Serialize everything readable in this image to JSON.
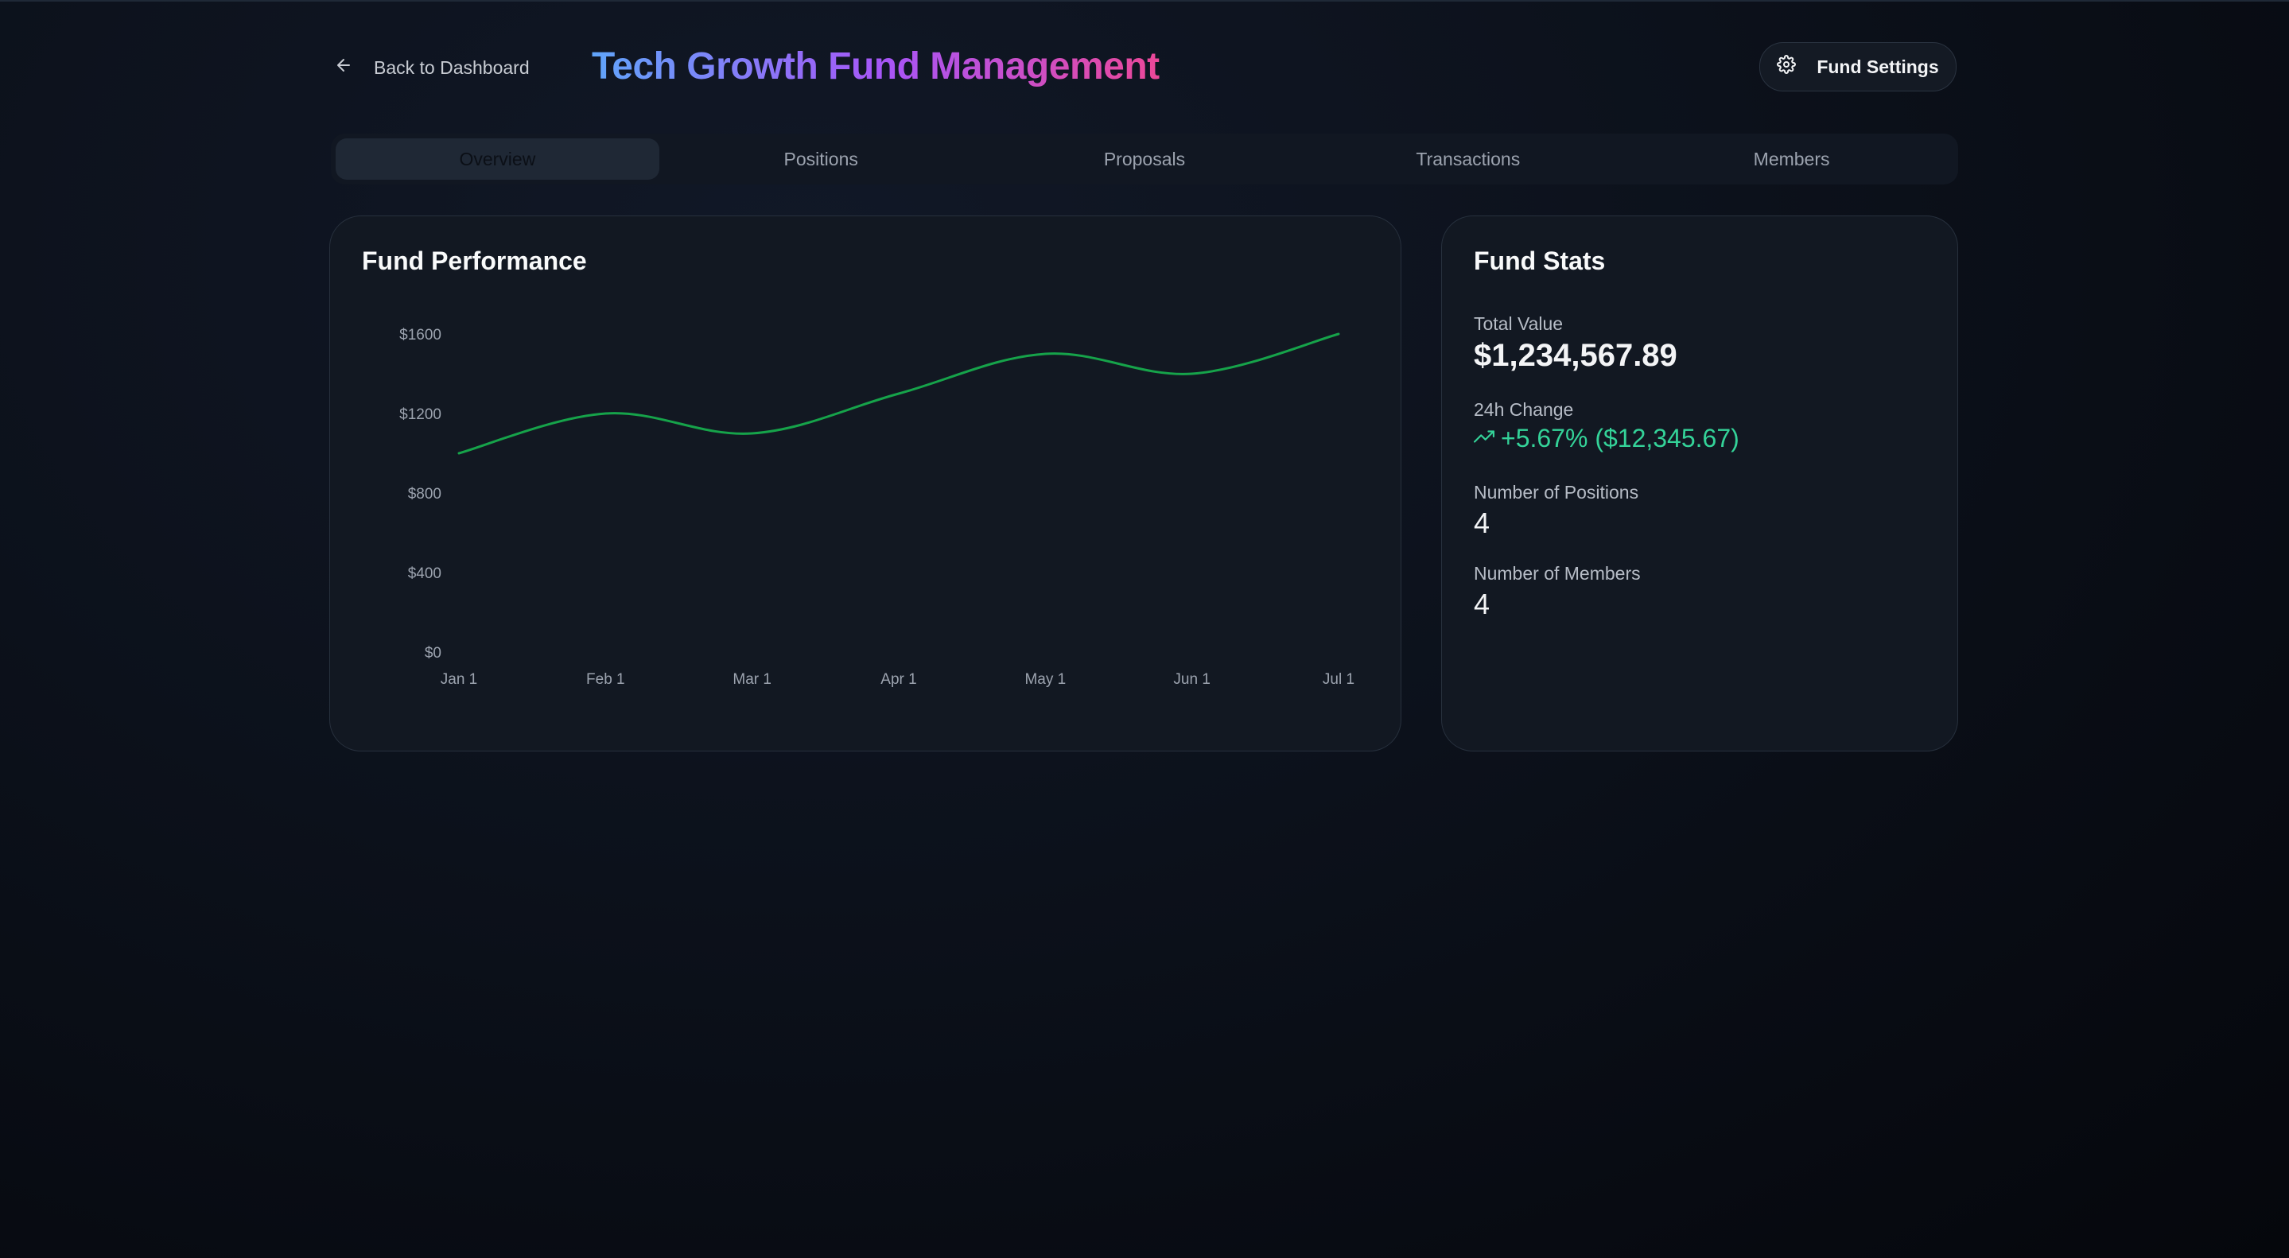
{
  "header": {
    "back_label": "Back to Dashboard",
    "title": "Tech Growth Fund Management",
    "settings_label": "Fund Settings"
  },
  "tabs": [
    {
      "label": "Overview",
      "active": true
    },
    {
      "label": "Positions",
      "active": false
    },
    {
      "label": "Proposals",
      "active": false
    },
    {
      "label": "Transactions",
      "active": false
    },
    {
      "label": "Members",
      "active": false
    }
  ],
  "performance": {
    "title": "Fund Performance"
  },
  "chart_data": {
    "type": "line",
    "title": "Fund Performance",
    "x": [
      "Jan 1",
      "Feb 1",
      "Mar 1",
      "Apr 1",
      "May 1",
      "Jun 1",
      "Jul 1"
    ],
    "series": [
      {
        "values": [
          1000,
          1200,
          1100,
          1300,
          1500,
          1400,
          1600
        ]
      }
    ],
    "yticks": [
      "$0",
      "$400",
      "$800",
      "$1200",
      "$1600"
    ],
    "ytick_values": [
      0,
      400,
      800,
      1200,
      1600
    ],
    "ylim": [
      0,
      1600
    ],
    "line_color": "#16a34a",
    "grid": false,
    "xlabel": "",
    "ylabel": ""
  },
  "stats": {
    "title": "Fund Stats",
    "total_value_label": "Total Value",
    "total_value": "$1,234,567.89",
    "change_label": "24h Change",
    "change_value": "+5.67% ($12,345.67)",
    "positions_label": "Number of Positions",
    "positions_value": "4",
    "members_label": "Number of Members",
    "members_value": "4"
  },
  "colors": {
    "accent_green": "#34d399",
    "title_gradient": [
      "#60a5fa",
      "#a855f7",
      "#ec4899"
    ]
  },
  "icons": {
    "back": "arrow-left-icon",
    "settings": "gear-icon",
    "change": "trending-up-icon"
  }
}
